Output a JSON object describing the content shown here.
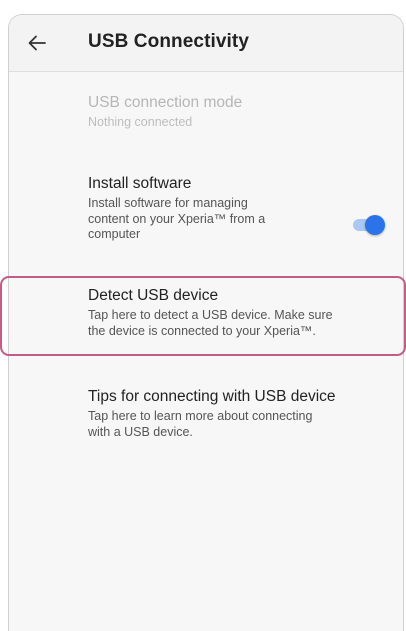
{
  "appbar": {
    "title": "USB Connectivity",
    "back_icon": "arrow-left-icon"
  },
  "items": [
    {
      "title": "USB connection mode",
      "summary": "Nothing connected",
      "enabled": false
    },
    {
      "title": "Install software",
      "summary_lines": [
        "Install software for managing",
        "content on your Xperia™ from a",
        "computer"
      ],
      "toggle_on": true
    },
    {
      "title": "Detect USB device",
      "summary_lines": [
        "Tap here to detect a USB device. Make sure",
        "the device is connected to your Xperia™."
      ],
      "highlighted": true
    },
    {
      "title": "Tips for connecting with USB device",
      "summary_lines": [
        "Tap here to learn more about connecting",
        "with a USB device."
      ]
    }
  ],
  "colors": {
    "toggle_thumb": "#2a73e8",
    "toggle_track": "#a9c8f4",
    "highlight_border": "#c45c84"
  }
}
